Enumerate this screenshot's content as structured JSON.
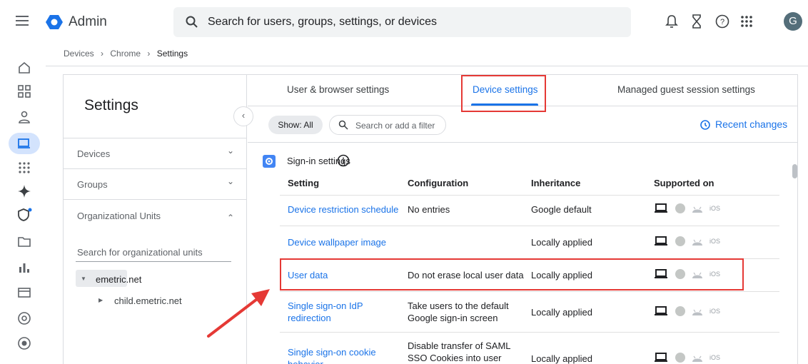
{
  "topbar": {
    "app_title": "Admin",
    "search_placeholder": "Search for users, groups, settings, or devices",
    "avatar_letter": "G"
  },
  "breadcrumb": {
    "part1": "Devices",
    "part2": "Chrome",
    "current": "Settings",
    "separator": "›"
  },
  "left_panel": {
    "title": "Settings",
    "nav": [
      {
        "label": "Devices",
        "chevron": "⌄"
      },
      {
        "label": "Groups",
        "chevron": "⌄"
      },
      {
        "label": "Organizational Units",
        "chevron": "⌃"
      }
    ],
    "ou_search_placeholder": "Search for organizational units",
    "ou_root": "emetric.net",
    "ou_child": "child.emetric.net"
  },
  "tabs": [
    {
      "label": "User & browser settings",
      "active": false
    },
    {
      "label": "Device settings",
      "active": true
    },
    {
      "label": "Managed guest session settings",
      "active": false
    }
  ],
  "filter": {
    "show_label": "Show: All",
    "search_placeholder": "Search or add a filter",
    "recent_changes": "Recent changes"
  },
  "section": {
    "title": "Sign-in settings",
    "columns": [
      "Setting",
      "Configuration",
      "Inheritance",
      "Supported on"
    ],
    "rows": [
      {
        "setting": [
          "Device restriction schedule"
        ],
        "configuration": [
          "No entries"
        ],
        "inheritance": "Google default"
      },
      {
        "setting": [
          "Device wallpaper image"
        ],
        "configuration": [
          ""
        ],
        "inheritance": "Locally applied"
      },
      {
        "setting": [
          "User data"
        ],
        "configuration": [
          "Do not erase local user data"
        ],
        "inheritance": "Locally applied"
      },
      {
        "setting": [
          "Single sign-on IdP",
          "redirection"
        ],
        "configuration": [
          "Take users to the default",
          "Google sign-in screen"
        ],
        "inheritance": "Locally applied"
      },
      {
        "setting": [
          "Single sign-on cookie",
          "behavior"
        ],
        "configuration": [
          "Disable transfer of SAML",
          "SSO Cookies into user"
        ],
        "inheritance": "Locally applied"
      }
    ],
    "ios_label": "iOS"
  },
  "colors": {
    "accent": "#1a73e8",
    "highlight": "#e53935"
  }
}
